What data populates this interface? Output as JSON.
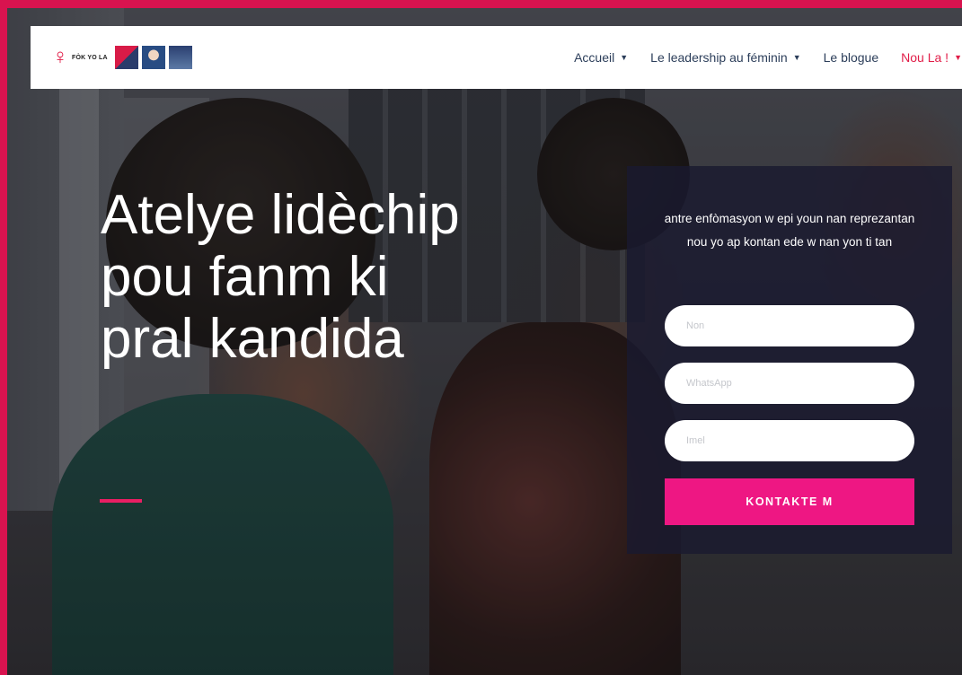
{
  "colors": {
    "border": "#d8134f",
    "accent": "#e11d48",
    "button": "#ee1783",
    "nav_text": "#2c3e5a",
    "panel": "#1a1a30"
  },
  "nav": {
    "logo_text": "FÒK YO LA",
    "items": [
      {
        "label": "Accueil",
        "has_dropdown": true
      },
      {
        "label": "Le leadership au féminin",
        "has_dropdown": true
      },
      {
        "label": "Le blogue",
        "has_dropdown": false
      },
      {
        "label": "Nou La !",
        "has_dropdown": true
      }
    ],
    "dropdown_icon": "caret-down-icon"
  },
  "hero": {
    "title": "Atelye lidèchip pou fanm ki pral kandida"
  },
  "form": {
    "intro": "antre enfòmasyon w epi youn nan reprezantan nou yo ap kontan ede w nan yon ti tan",
    "fields": [
      {
        "placeholder": "Non",
        "value": ""
      },
      {
        "placeholder": "WhatsApp",
        "value": ""
      },
      {
        "placeholder": "Imel",
        "value": ""
      }
    ],
    "submit_label": "KONTAKTE M"
  }
}
